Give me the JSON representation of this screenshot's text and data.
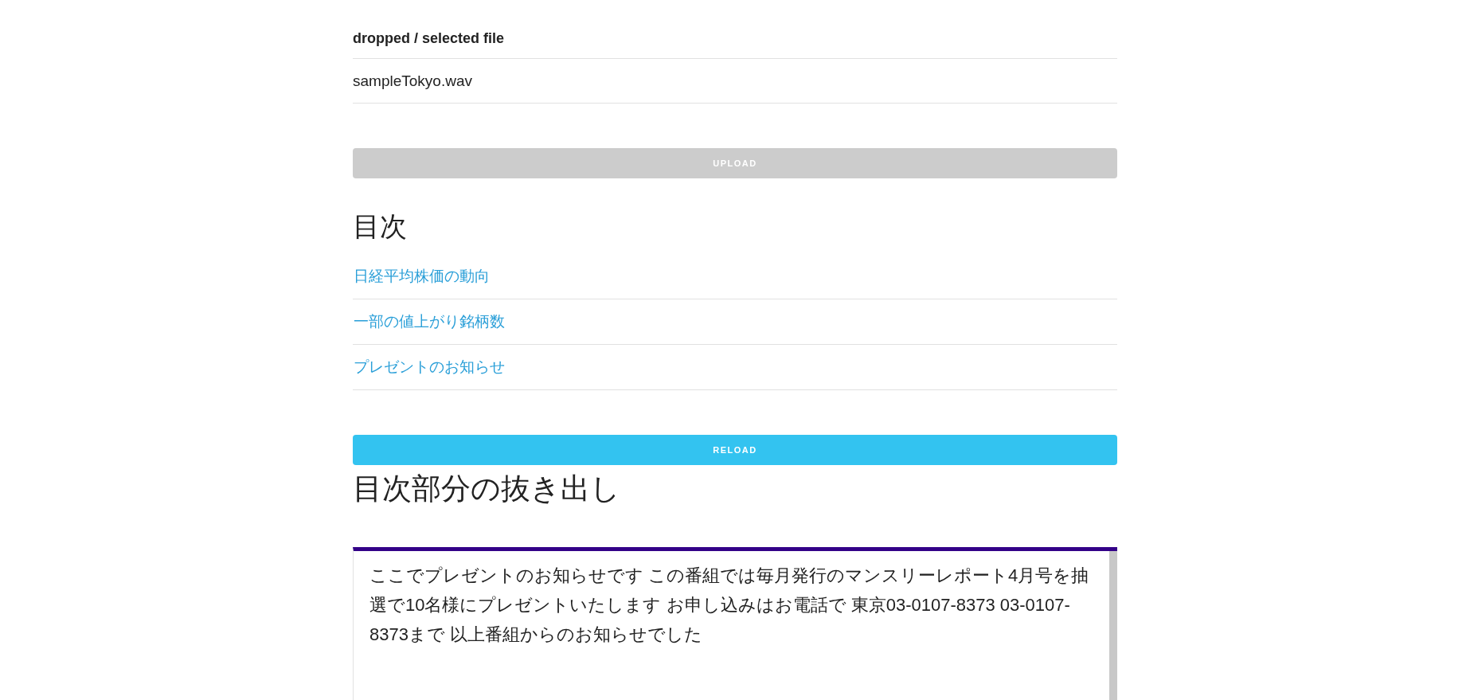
{
  "file_table": {
    "heading": "dropped / selected file",
    "files": [
      "sampleTokyo.wav"
    ]
  },
  "upload_button": {
    "label": "UPLOAD",
    "disabled": true
  },
  "toc": {
    "title": "目次",
    "links": [
      "日経平均株価の動向",
      "一部の値上がり銘柄数",
      "プレゼントのお知らせ"
    ]
  },
  "reload_button": {
    "label": "RELOAD",
    "disabled": false
  },
  "extract": {
    "title": "目次部分の抜き出し",
    "text": "ここでプレゼントのお知らせです この番組では毎月発行のマンスリーレポート4月号を抽選で10名様にプレゼントいたします お申し込みはお電話で 東京03-0107-8373 03-0107-8373まで 以上番組からのお知らせでした"
  }
}
